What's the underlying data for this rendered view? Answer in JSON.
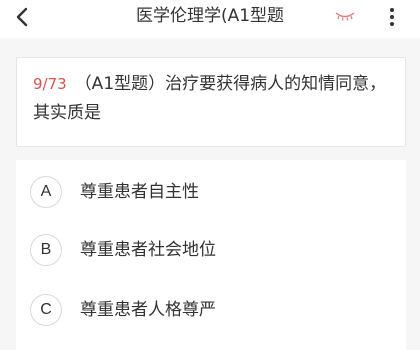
{
  "header": {
    "title": "医学伦理学(A1型题",
    "back_icon": "chevron-left-icon",
    "eye_icon": "eye-closed-icon",
    "more_icon": "more-vertical-icon",
    "accent_color": "#e07a73"
  },
  "question": {
    "number": "9/73",
    "text": "（A1型题）治疗要获得病人的知情同意，其实质是"
  },
  "options": [
    {
      "letter": "A",
      "text": "尊重患者自主性"
    },
    {
      "letter": "B",
      "text": "尊重患者社会地位"
    },
    {
      "letter": "C",
      "text": "尊重患者人格尊严"
    }
  ]
}
